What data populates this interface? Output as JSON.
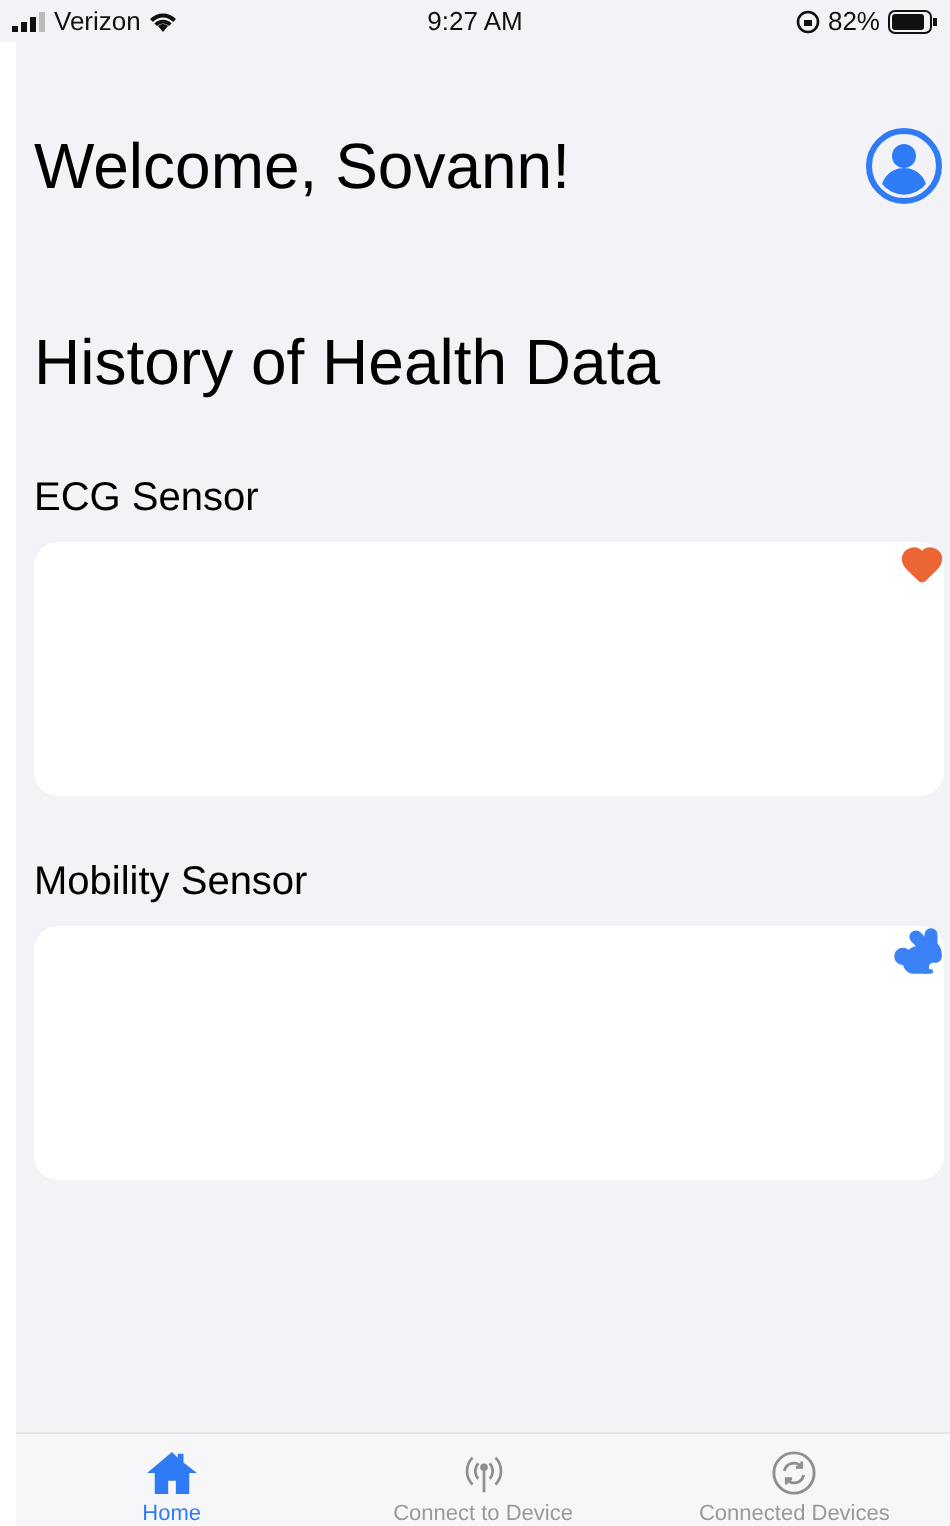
{
  "status_bar": {
    "carrier": "Verizon",
    "time": "9:27 AM",
    "battery": "82%"
  },
  "greeting": "Welcome, Sovann!",
  "title": "History of Health Data",
  "sensors": [
    {
      "label": "ECG Sensor",
      "kind": "heart",
      "color": "#ec6535"
    },
    {
      "label": "Mobility Sensor",
      "kind": "rabbit",
      "color": "#3b82f6"
    }
  ],
  "tabs": [
    {
      "label": "Home",
      "kind": "home",
      "selected": true
    },
    {
      "label": "Connect to Device",
      "kind": "antenna",
      "selected": false
    },
    {
      "label": "Connected Devices",
      "kind": "sync",
      "selected": false
    }
  ]
}
